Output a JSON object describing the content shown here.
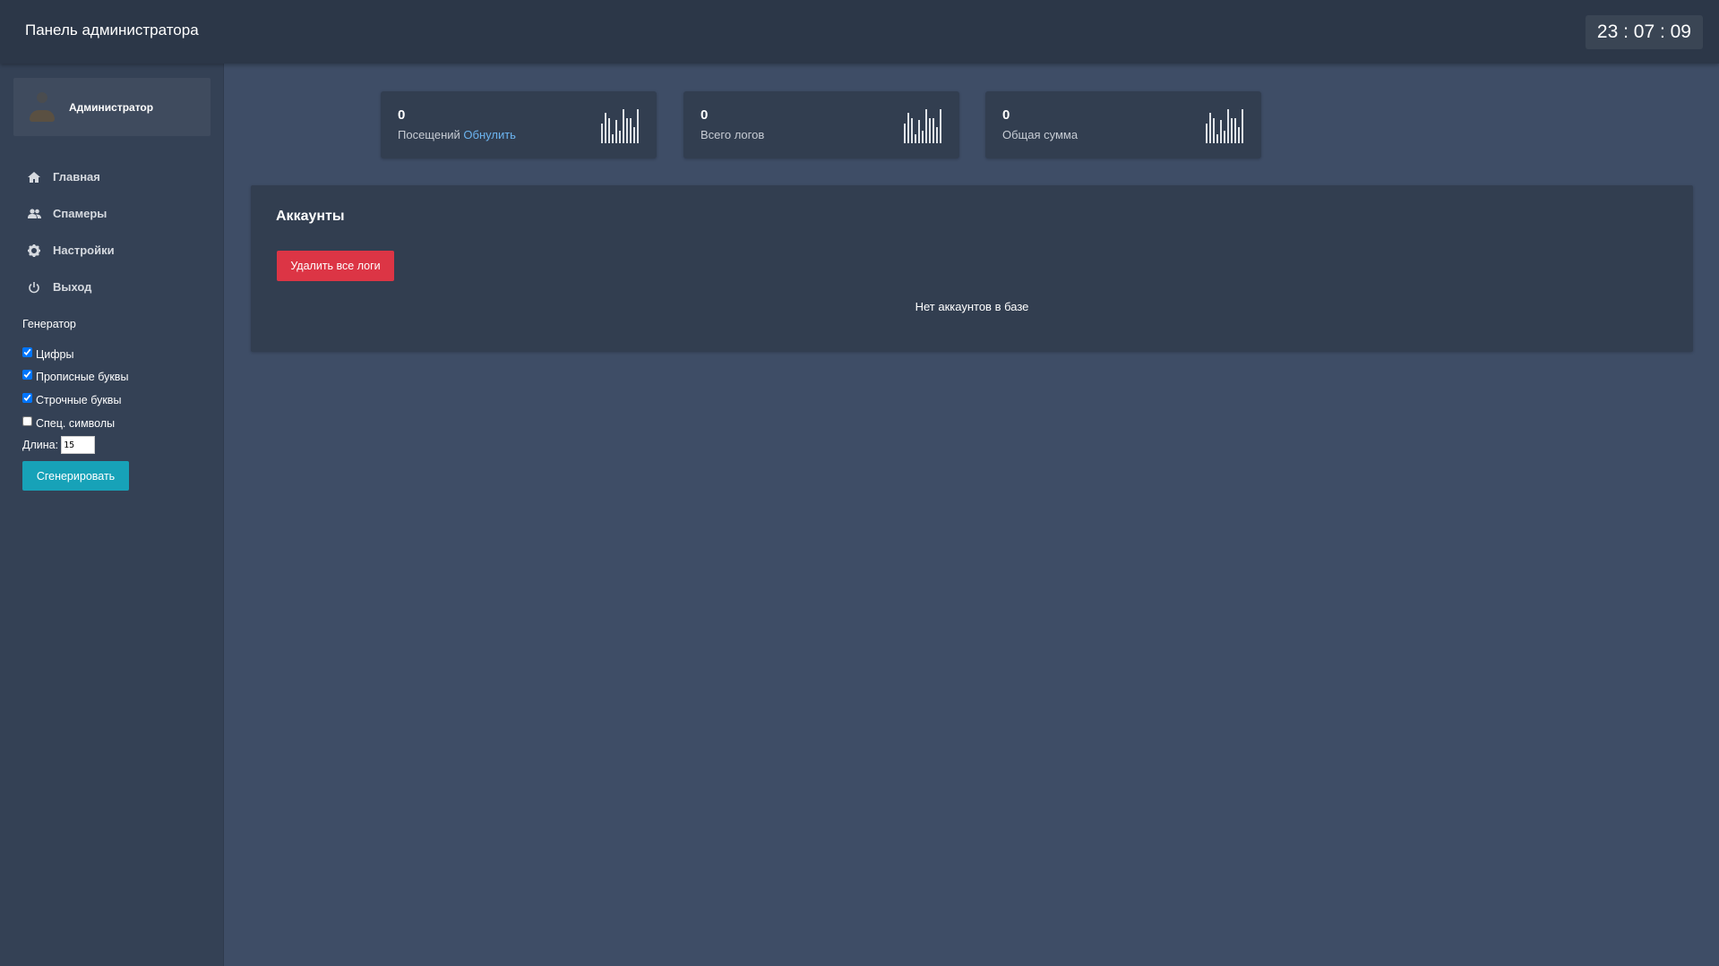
{
  "header": {
    "title": "Панель администратора",
    "clock": "23 : 07 : 09"
  },
  "sidebar": {
    "user": "Администратор",
    "nav": [
      {
        "label": "Главная",
        "icon": "home-icon"
      },
      {
        "label": "Спамеры",
        "icon": "users-icon"
      },
      {
        "label": "Настройки",
        "icon": "gear-icon"
      },
      {
        "label": "Выход",
        "icon": "power-icon"
      }
    ],
    "generator": {
      "title": "Генератор",
      "options": [
        {
          "label": "Цифры",
          "checked": true
        },
        {
          "label": "Прописные буквы",
          "checked": true
        },
        {
          "label": "Строчные буквы",
          "checked": true
        },
        {
          "label": "Спец. символы",
          "checked": false
        }
      ],
      "length_label": "Длина:",
      "length_value": "15",
      "button": "Сгенерировать"
    }
  },
  "stats": [
    {
      "value": "0",
      "label": "Посещений",
      "link": "Обнулить"
    },
    {
      "value": "0",
      "label": "Всего логов"
    },
    {
      "value": "0",
      "label": "Общая сумма"
    }
  ],
  "accounts": {
    "title": "Аккаунты",
    "delete_button": "Удалить все логи",
    "empty_text": "Нет аккаунтов в базе"
  },
  "colors": {
    "danger": "#dc3545",
    "info": "#17a2b8",
    "link": "#6cb4f0"
  }
}
